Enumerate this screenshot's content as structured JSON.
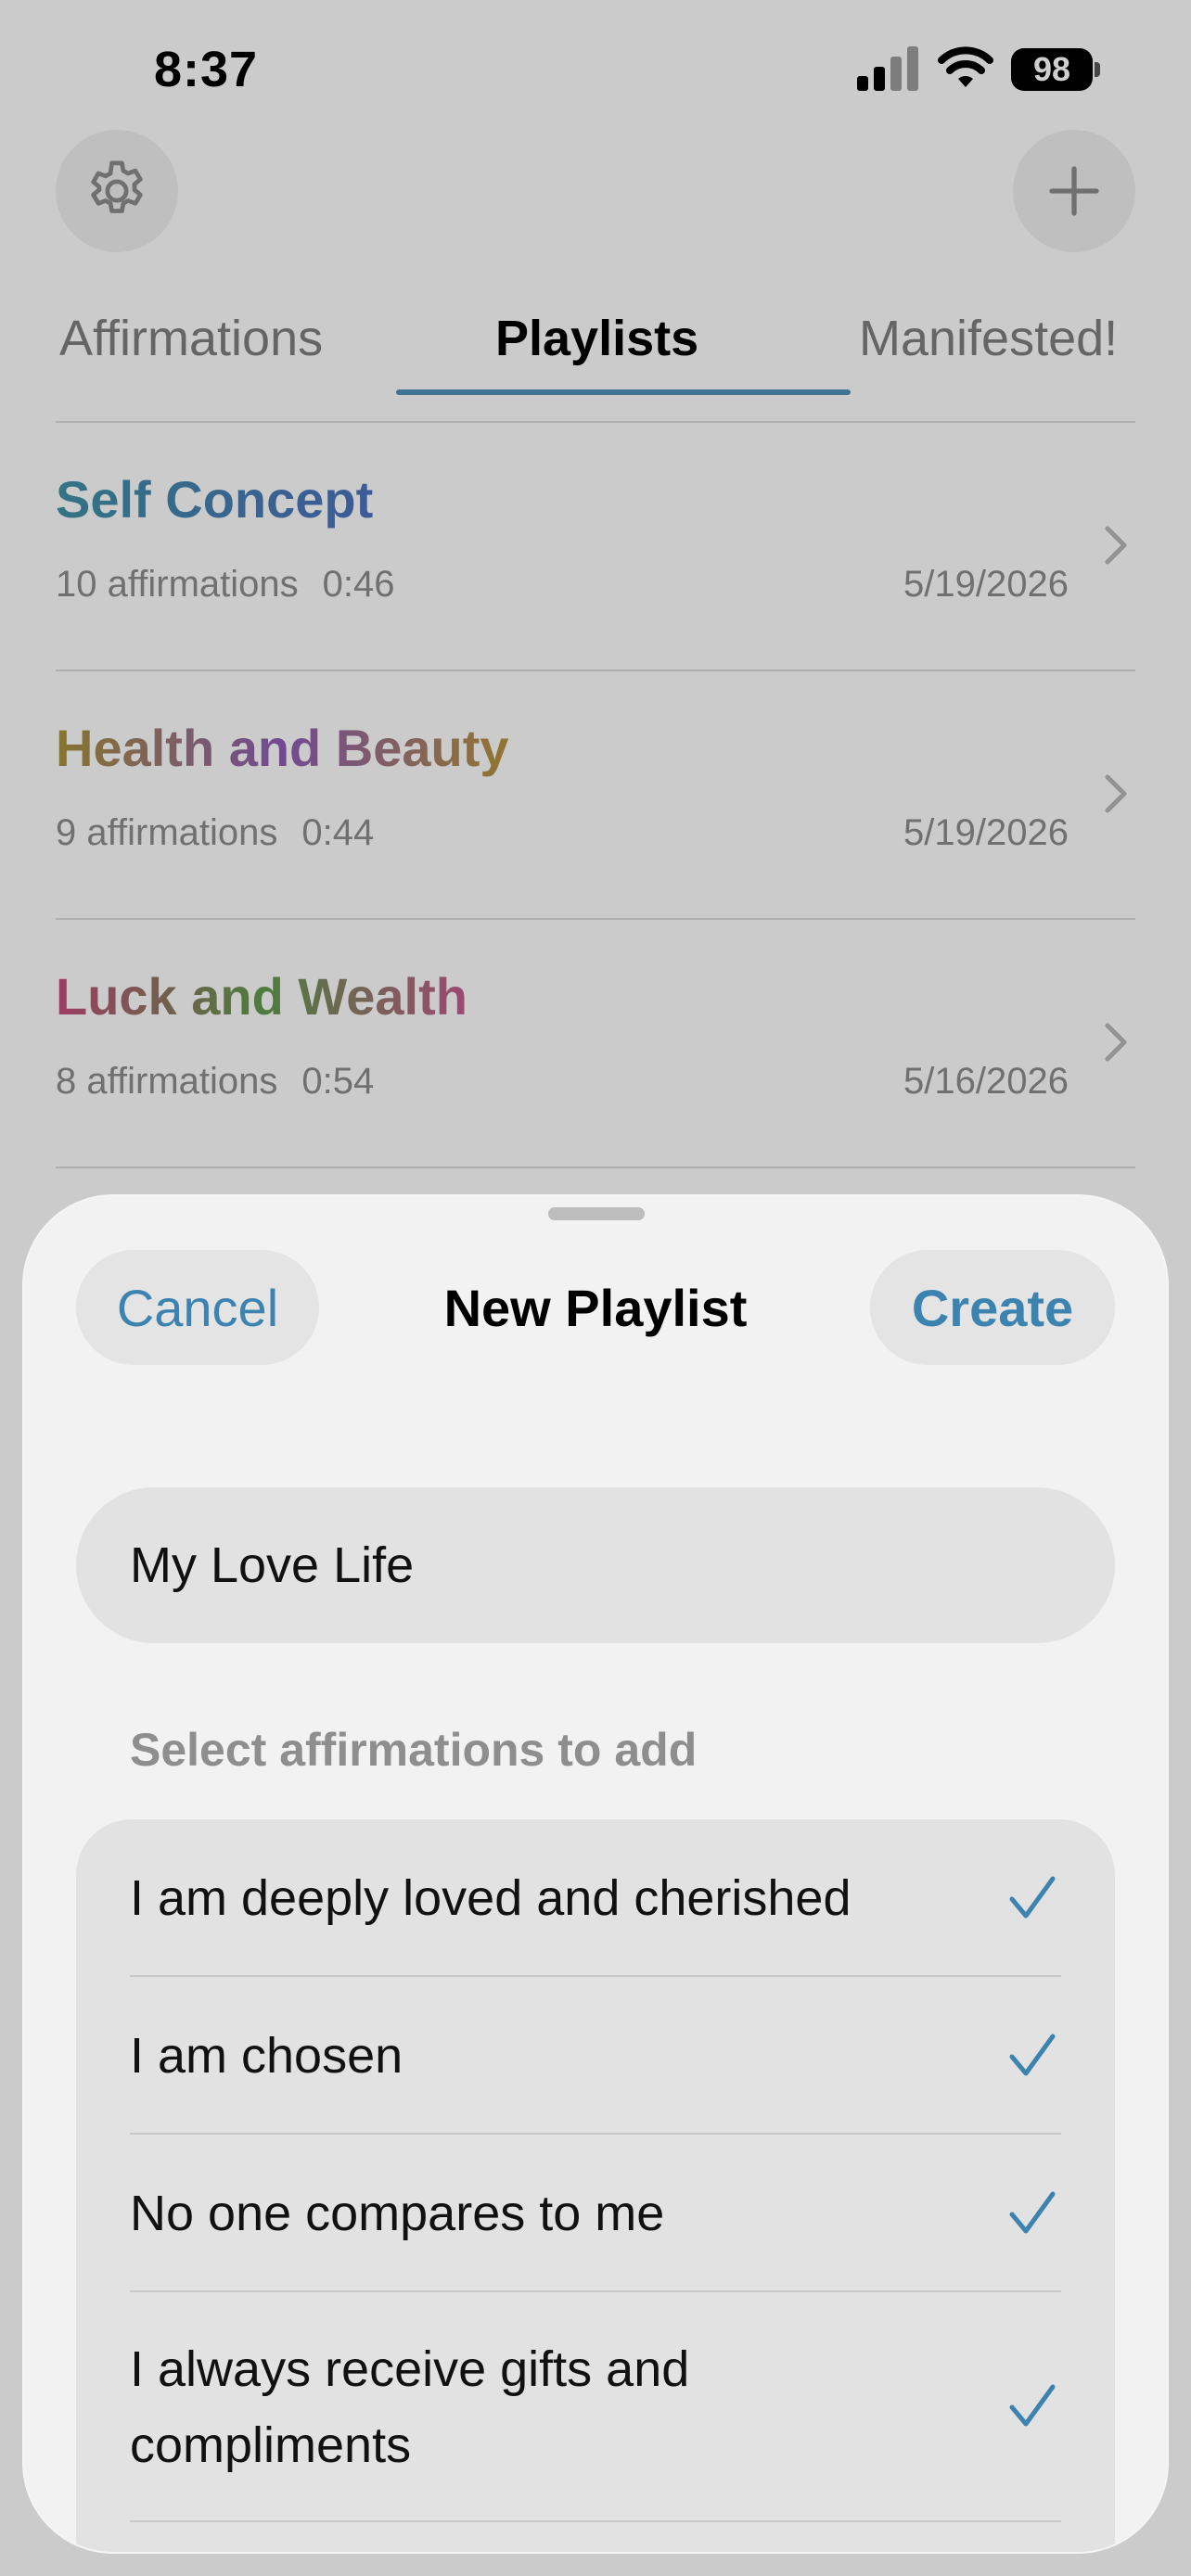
{
  "status_bar": {
    "time": "8:37",
    "battery": "98"
  },
  "header": {
    "settings_icon": "gear-icon",
    "add_icon": "plus-icon"
  },
  "tabs": [
    {
      "label": "Affirmations",
      "active": false
    },
    {
      "label": "Playlists",
      "active": true
    },
    {
      "label": "Manifested!",
      "active": false
    }
  ],
  "playlists": [
    {
      "title": "Self Concept",
      "count": "10 affirmations",
      "duration": "0:46",
      "date": "5/19/2026"
    },
    {
      "title": "Health and Beauty",
      "count": "9 affirmations",
      "duration": "0:44",
      "date": "5/19/2026"
    },
    {
      "title": "Luck and Wealth",
      "count": "8 affirmations",
      "duration": "0:54",
      "date": "5/16/2026"
    }
  ],
  "sheet": {
    "cancel_label": "Cancel",
    "title": "New Playlist",
    "create_label": "Create",
    "name_value": "My Love Life",
    "section_label": "Select affirmations to add",
    "affirmations": [
      {
        "text": "I am deeply loved and cherished",
        "selected": true
      },
      {
        "text": "I am chosen",
        "selected": true
      },
      {
        "text": "No one compares to me",
        "selected": true
      },
      {
        "text": "I always receive gifts and compliments",
        "selected": true
      }
    ]
  },
  "colors": {
    "accent": "#3d83b0",
    "tab_underline": "#4f8fb8",
    "check": "#3d83b0"
  }
}
